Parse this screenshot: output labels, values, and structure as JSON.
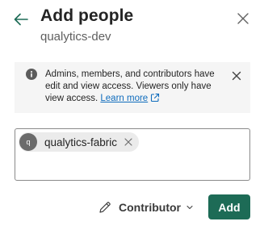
{
  "header": {
    "title": "Add people",
    "subtitle": "qualytics-dev",
    "back_icon": "arrow-left-icon",
    "close_icon": "close-icon"
  },
  "info_bar": {
    "message": "Admins, members, and contributors have edit and view access. Viewers only have view access.",
    "link_label": "Learn more",
    "icon": "info-icon",
    "external_icon": "external-link-icon",
    "dismiss_icon": "close-icon"
  },
  "people_input": {
    "chips": [
      {
        "avatar_initial": "q",
        "label": "qualytics-fabric"
      }
    ]
  },
  "footer": {
    "role_label": "Contributor",
    "role_icon": "pencil-icon",
    "add_label": "Add"
  },
  "colors": {
    "accent": "#1d6b56",
    "link": "#0f6cbd",
    "info_background": "#f5f5f5"
  }
}
